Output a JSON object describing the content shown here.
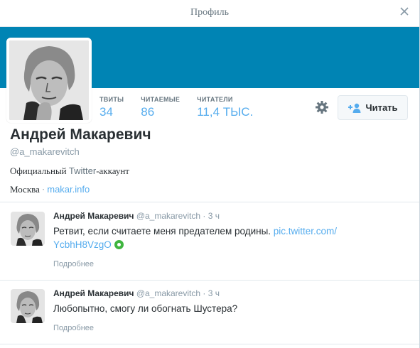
{
  "dialog": {
    "title": "Профиль",
    "close_icon": "close-icon"
  },
  "colors": {
    "banner": "#0084b4",
    "accent": "#55acee",
    "muted": "#8899a6"
  },
  "profile": {
    "name": "Андрей Макаревич",
    "handle": "@a_makarevitch",
    "bio_prefix": "Официальный ",
    "bio_twitter": "Twitter",
    "bio_suffix": "-аккаунт",
    "location": "Москва",
    "separator": "·",
    "url": "makar.info",
    "stats": [
      {
        "label": "ТВИТЫ",
        "value": "34"
      },
      {
        "label": "ЧИТАЕМЫЕ",
        "value": "86"
      },
      {
        "label": "ЧИТАТЕЛИ",
        "value": "11,4 ТЫС."
      }
    ],
    "settings_icon": "gear-icon",
    "follow_label": "Читать",
    "follow_icon": "add-person-icon"
  },
  "tweets": [
    {
      "name": "Андрей Макаревич",
      "handle": "@a_makarevitch",
      "time": "· 3 ч",
      "text": "Ретвит, если считаете меня предателем родины. ",
      "link1": "pic.twitter.com/",
      "link2": "YcbhH8VzgO",
      "more": "Подробнее"
    },
    {
      "name": "Андрей Макаревич",
      "handle": "@a_makarevitch",
      "time": "· 3 ч",
      "text": "Любопытно, смогу ли обогнать Шустера?",
      "more": "Подробнее"
    }
  ]
}
